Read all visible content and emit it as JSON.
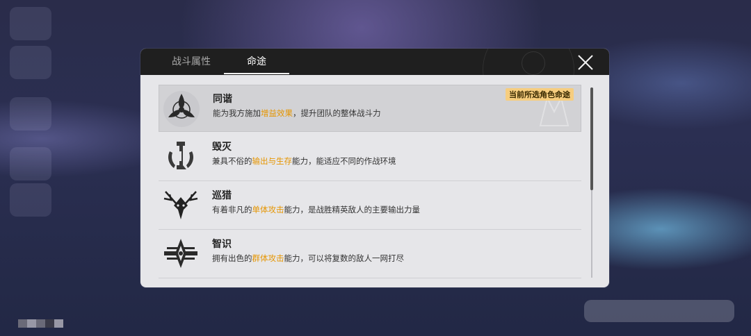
{
  "tabs": [
    {
      "label": "战斗属性"
    },
    {
      "label": "命途"
    }
  ],
  "paths": [
    {
      "name": "同谐",
      "desc_pre": "能为我方施加",
      "desc_highlight": "增益效果",
      "desc_post": "，提升团队的整体战斗力",
      "badge": "当前所选角色命途",
      "icon": "harmony-icon"
    },
    {
      "name": "毁灭",
      "desc_pre": "兼具不俗的",
      "desc_highlight": "输出与生存",
      "desc_post": "能力，能适应不同的作战环境",
      "icon": "destruction-icon"
    },
    {
      "name": "巡猎",
      "desc_pre": "有着非凡的",
      "desc_highlight": "单体攻击",
      "desc_post": "能力，是战胜精英敌人的主要输出力量",
      "icon": "hunt-icon"
    },
    {
      "name": "智识",
      "desc_pre": "拥有出色的",
      "desc_highlight": "群体攻击",
      "desc_post": "能力，可以将复数的敌人一网打尽",
      "icon": "erudition-icon"
    }
  ],
  "colors": {
    "highlight": "#e59500",
    "badge_bg": "#f6cd7f",
    "header_bg": "#1f1f1f",
    "panel_bg": "#e6e6e9"
  }
}
